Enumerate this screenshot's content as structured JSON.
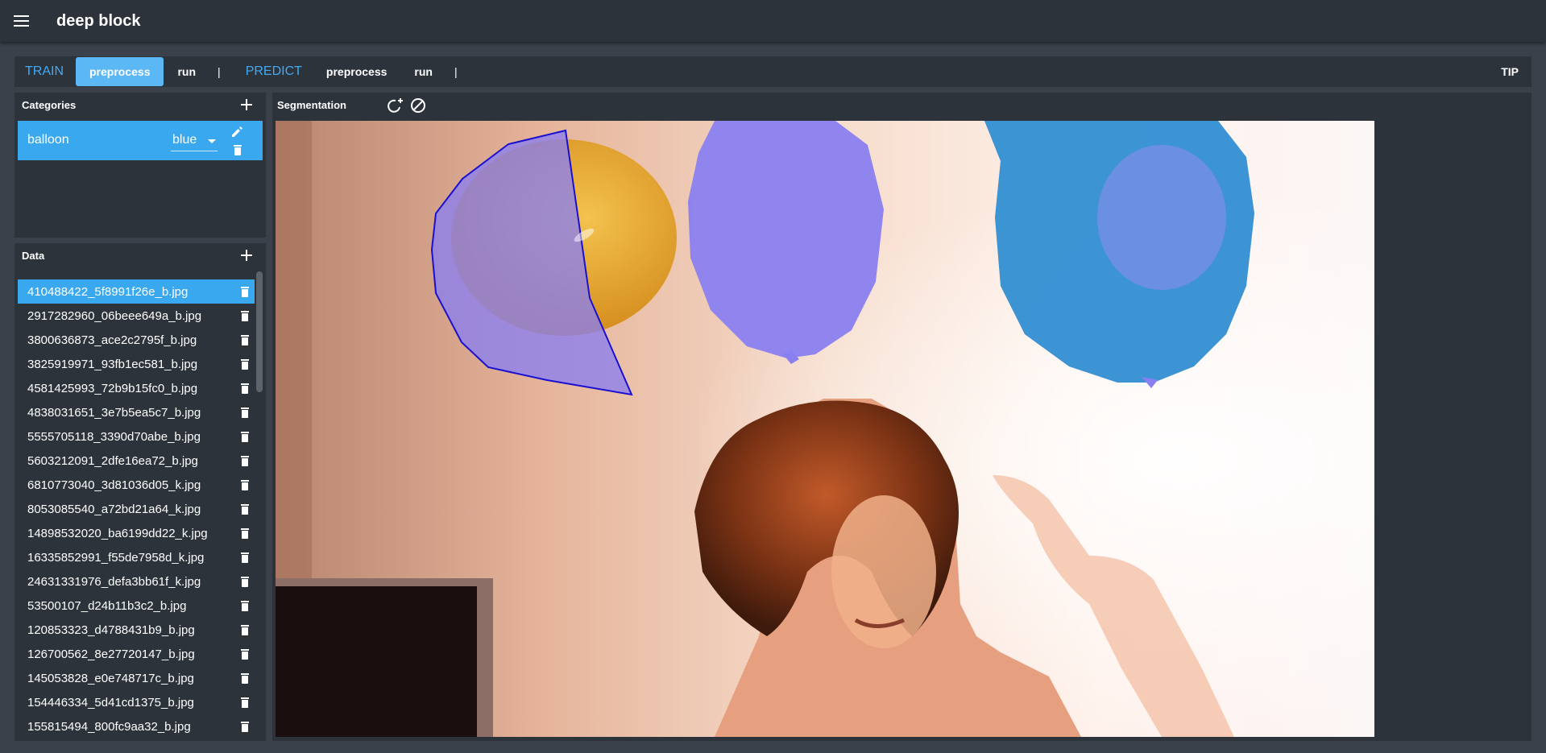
{
  "app": {
    "title": "deep block"
  },
  "toolbar": {
    "train_label": "TRAIN",
    "train_preprocess": "preprocess",
    "train_run": "run",
    "separator": "|",
    "predict_label": "PREDICT",
    "predict_preprocess": "preprocess",
    "predict_run": "run",
    "tip": "TIP"
  },
  "categories": {
    "title": "Categories",
    "items": [
      {
        "name": "balloon",
        "color": "blue"
      }
    ]
  },
  "data": {
    "title": "Data",
    "selected_index": 0,
    "files": [
      "410488422_5f8991f26e_b.jpg",
      "2917282960_06beee649a_b.jpg",
      "3800636873_ace2c2795f_b.jpg",
      "3825919971_93fb1ec581_b.jpg",
      "4581425993_72b9b15fc0_b.jpg",
      "4838031651_3e7b5ea5c7_b.jpg",
      "5555705118_3390d70abe_b.jpg",
      "5603212091_2dfe16ea72_b.jpg",
      "6810773040_3d81036d05_k.jpg",
      "8053085540_a72bd21a64_k.jpg",
      "14898532020_ba6199dd22_k.jpg",
      "16335852991_f55de7958d_k.jpg",
      "24631331976_defa3bb61f_k.jpg",
      "53500107_d24b11b3c2_b.jpg",
      "120853323_d4788431b9_b.jpg",
      "126700562_8e27720147_b.jpg",
      "145053828_e0e748717c_b.jpg",
      "154446334_5d41cd1375_b.jpg",
      "155815494_800fc9aa32_b.jpg"
    ]
  },
  "segmentation": {
    "title": "Segmentation",
    "tools": [
      "add-polygon-icon",
      "clear-icon"
    ]
  },
  "colors": {
    "accent": "#41aaf5",
    "selected_row": "#3aa8ee",
    "active_button": "#5bb8f5",
    "panel_bg": "#2d333b",
    "page_bg": "#3a414a",
    "mask_fill": "#8a7ff0",
    "polygon_stroke": "#1a10d0"
  }
}
